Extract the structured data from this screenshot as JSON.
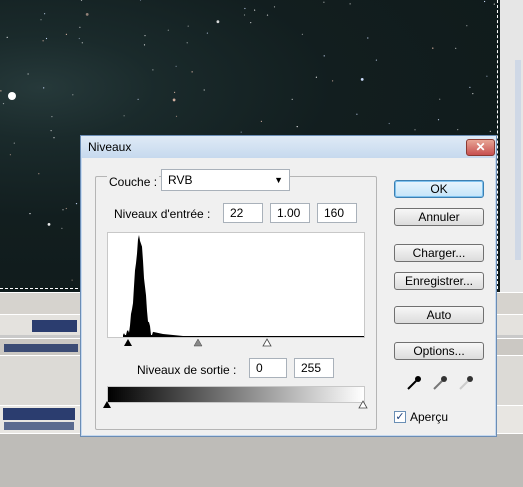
{
  "dialog": {
    "title": "Niveaux",
    "close_label": "✕",
    "channel": {
      "label": "Couche :",
      "value": "RVB"
    },
    "input_levels": {
      "label": "Niveaux d'entrée :",
      "black": "22",
      "gamma": "1.00",
      "white": "160"
    },
    "output_levels": {
      "label": "Niveaux de sortie :",
      "black": "0",
      "white": "255"
    },
    "buttons": {
      "ok": "OK",
      "cancel": "Annuler",
      "load": "Charger...",
      "save": "Enregistrer...",
      "auto": "Auto",
      "options": "Options..."
    },
    "preview": {
      "label": "Aperçu",
      "checked": true,
      "check_glyph": "✓"
    },
    "eyedroppers": [
      "black-eyedropper-icon",
      "gray-eyedropper-icon",
      "white-eyedropper-icon"
    ]
  },
  "histogram": {
    "peak_range": [
      15,
      45
    ],
    "slider_positions": {
      "black": 22,
      "gamma": 1.0,
      "white": 160
    }
  },
  "colors": {
    "titlebar": "#c6d9ee",
    "close": "#c75050",
    "dialog_bg": "#f0f0f0",
    "ok_border": "#3c7fb1"
  }
}
